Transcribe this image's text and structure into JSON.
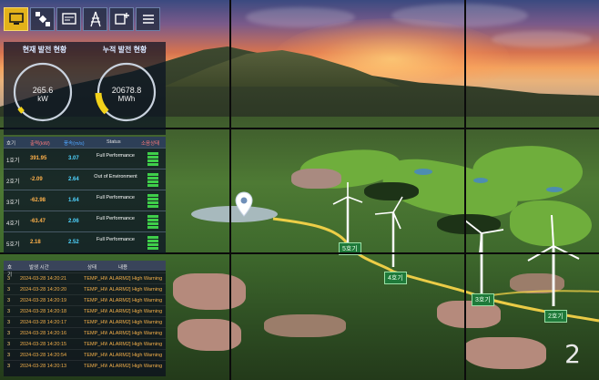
{
  "panel": {
    "toolbar": [
      {
        "icon": "monitor-icon",
        "active": true
      },
      {
        "icon": "satellite-icon",
        "active": false
      },
      {
        "icon": "dashboard-icon",
        "active": false
      },
      {
        "icon": "power-grid-icon",
        "active": false
      },
      {
        "icon": "add-device-icon",
        "active": false
      },
      {
        "icon": "menu-icon",
        "active": false
      }
    ],
    "gauges": [
      {
        "title": "현재 발전 현황",
        "value": "265.6",
        "unit": "kW",
        "fraction": 0.04
      },
      {
        "title": "누적 발전 현황",
        "value": "20678.8",
        "unit": "MWh",
        "fraction": 0.16
      }
    ],
    "table": {
      "headers": [
        "호기",
        "출력(kW)",
        "풍속(m/s)",
        "Status",
        "소음상태"
      ],
      "rows": [
        {
          "id": "1호기",
          "output": "391.95",
          "wind": "3.07",
          "status": "Full Performance"
        },
        {
          "id": "2호기",
          "output": "-2.09",
          "wind": "2.64",
          "status": "Out of Environment"
        },
        {
          "id": "3호기",
          "output": "-62.98",
          "wind": "1.64",
          "status": "Full Performance"
        },
        {
          "id": "4호기",
          "output": "-63.47",
          "wind": "2.06",
          "status": "Full Performance"
        },
        {
          "id": "5호기",
          "output": "2.18",
          "wind": "2.52",
          "status": "Full Performance"
        }
      ]
    },
    "log": {
      "headers": [
        "호기",
        "발생 시간",
        "상태",
        "내용"
      ],
      "rows": [
        {
          "unit": "3",
          "time": "2024-03-28 14:20:21",
          "state": "TEMP_HW",
          "content": "ALARM2] High Warning"
        },
        {
          "unit": "3",
          "time": "2024-03-28 14:20:20",
          "state": "TEMP_HW",
          "content": "ALARM2] High Warning"
        },
        {
          "unit": "3",
          "time": "2024-03-28 14:20:19",
          "state": "TEMP_HW",
          "content": "ALARM2] High Warning"
        },
        {
          "unit": "3",
          "time": "2024-03-28 14:20:18",
          "state": "TEMP_HW",
          "content": "ALARM2] High Warning"
        },
        {
          "unit": "3",
          "time": "2024-03-28 14:20:17",
          "state": "TEMP_HW",
          "content": "ALARM2] High Warning"
        },
        {
          "unit": "3",
          "time": "2024-03-28 14:20:16",
          "state": "TEMP_HW",
          "content": "ALARM2] High Warning"
        },
        {
          "unit": "3",
          "time": "2024-03-28 14:20:15",
          "state": "TEMP_HW",
          "content": "ALARM2] High Warning"
        },
        {
          "unit": "3",
          "time": "2024-03-28 14:20:54",
          "state": "TEMP_HW",
          "content": "ALARM2] High Warning"
        },
        {
          "unit": "3",
          "time": "2024-03-28 14:20:13",
          "state": "TEMP_HW",
          "content": "ALARM2] High Warning"
        }
      ]
    }
  },
  "scene": {
    "turbine_labels": [
      "5호기",
      "4호기",
      "3호기",
      "2호기"
    ],
    "screen_number": "2"
  },
  "colors": {
    "active_tool": "#e3b21a",
    "output_text": "#ffb14a",
    "wind_text": "#4fd4ff",
    "status_ok": "#3fcf4a",
    "route": "#ffd84a",
    "log_text": "#f4b04a"
  }
}
